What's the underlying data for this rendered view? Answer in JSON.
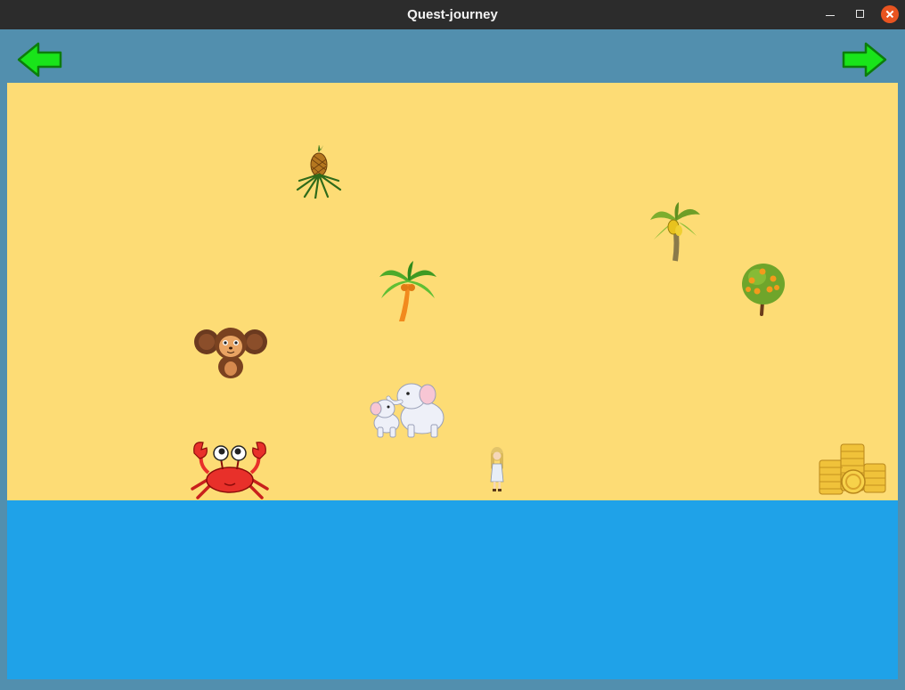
{
  "window": {
    "title": "Quest-journey",
    "controls": [
      "minimize",
      "maximize",
      "close"
    ]
  },
  "navigation": {
    "prev_icon": "arrow-left-icon",
    "next_icon": "arrow-right-icon",
    "arrow_color": "#19e41a"
  },
  "scene": {
    "sand_color": "#fddc75",
    "sea_color": "#1fa2e8",
    "frame_color": "#528fae",
    "objects": [
      "pineapple-icon",
      "banana-palm-icon",
      "orange-tree-icon",
      "coconut-palm-icon",
      "cheburashka-icon",
      "elephants-icon",
      "crab-icon",
      "girl-player-icon",
      "gold-coins-icon"
    ]
  }
}
